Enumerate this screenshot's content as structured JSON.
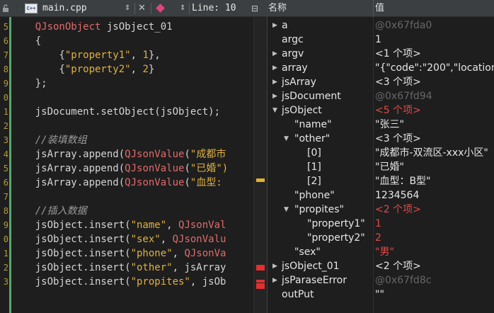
{
  "editor": {
    "file_name": "main.cpp",
    "file_dropdown_glyph": "⇕",
    "close_glyph": "✕",
    "symbol_dropdown_glyph": "⇕",
    "cursor_position": "Line: 10",
    "split_glyph": "⊟",
    "file_type_label": "C++",
    "line_numbers": [
      "5",
      "6",
      "7",
      "8",
      "9",
      "0",
      "1",
      "2",
      "3",
      "4",
      "5",
      "6",
      "7",
      "8",
      "9",
      "0",
      "1",
      "2",
      "3"
    ],
    "lines": [
      [
        {
          "t": "typ",
          "v": "    QJsonObject"
        },
        {
          "t": "pun",
          "v": " jsObject_01"
        }
      ],
      [
        {
          "t": "pun",
          "v": "    {"
        }
      ],
      [
        {
          "t": "pun",
          "v": "        {"
        },
        {
          "t": "str",
          "v": "\"property1\""
        },
        {
          "t": "pun",
          "v": ", "
        },
        {
          "t": "num",
          "v": "1"
        },
        {
          "t": "pun",
          "v": "},"
        }
      ],
      [
        {
          "t": "pun",
          "v": "        {"
        },
        {
          "t": "str",
          "v": "\"property2\""
        },
        {
          "t": "pun",
          "v": ", "
        },
        {
          "t": "num",
          "v": "2"
        },
        {
          "t": "pun",
          "v": "}"
        }
      ],
      [
        {
          "t": "pun",
          "v": "    };"
        }
      ],
      [
        {
          "t": "pun",
          "v": ""
        }
      ],
      [
        {
          "t": "fn",
          "v": "    jsDocument.setObject(jsObject);"
        }
      ],
      [
        {
          "t": "pun",
          "v": ""
        }
      ],
      [
        {
          "t": "cmt",
          "v": "    //装填数组"
        }
      ],
      [
        {
          "t": "fn",
          "v": "    jsArray.append("
        },
        {
          "t": "typ",
          "v": "QJsonValue"
        },
        {
          "t": "pun",
          "v": "("
        },
        {
          "t": "str",
          "v": "\"成都市"
        }
      ],
      [
        {
          "t": "fn",
          "v": "    jsArray.append("
        },
        {
          "t": "typ",
          "v": "QJsonValue"
        },
        {
          "t": "pun",
          "v": "("
        },
        {
          "t": "str",
          "v": "\"已婚\")"
        }
      ],
      [
        {
          "t": "fn",
          "v": "    jsArray.append("
        },
        {
          "t": "typ",
          "v": "QJsonValue"
        },
        {
          "t": "pun",
          "v": "("
        },
        {
          "t": "str",
          "v": "\"血型:"
        }
      ],
      [
        {
          "t": "pun",
          "v": ""
        }
      ],
      [
        {
          "t": "cmt",
          "v": "    //插入数据"
        }
      ],
      [
        {
          "t": "fn",
          "v": "    jsObject.insert("
        },
        {
          "t": "str",
          "v": "\"name\""
        },
        {
          "t": "pun",
          "v": ", "
        },
        {
          "t": "typ",
          "v": "QJsonVal"
        }
      ],
      [
        {
          "t": "fn",
          "v": "    jsObject.insert("
        },
        {
          "t": "str",
          "v": "\"sex\""
        },
        {
          "t": "pun",
          "v": ", "
        },
        {
          "t": "typ",
          "v": "QJsonValu"
        }
      ],
      [
        {
          "t": "fn",
          "v": "    jsObject.insert("
        },
        {
          "t": "str",
          "v": "\"phone\""
        },
        {
          "t": "pun",
          "v": ", "
        },
        {
          "t": "typ",
          "v": "QJsonVa"
        }
      ],
      [
        {
          "t": "fn",
          "v": "    jsObject.insert("
        },
        {
          "t": "str",
          "v": "\"other\""
        },
        {
          "t": "pun",
          "v": ", jsArray"
        }
      ],
      [
        {
          "t": "fn",
          "v": "    jsObject.insert("
        },
        {
          "t": "str",
          "v": "\"propites\""
        },
        {
          "t": "pun",
          "v": ", jsOb"
        }
      ]
    ]
  },
  "locals": {
    "header_name": "名称",
    "header_value": "值",
    "rows": [
      {
        "depth": 0,
        "arrow": "▶",
        "name": "a",
        "value": "@0x67fda0",
        "style": "addr"
      },
      {
        "depth": 0,
        "arrow": "",
        "name": "argc",
        "value": "1",
        "style": ""
      },
      {
        "depth": 0,
        "arrow": "▶",
        "name": "argv",
        "value": "<1 个项>",
        "style": ""
      },
      {
        "depth": 0,
        "arrow": "▶",
        "name": "array",
        "value": "\"{\"code\":\"200\",\"location",
        "style": ""
      },
      {
        "depth": 0,
        "arrow": "▶",
        "name": "jsArray",
        "value": "<3 个项>",
        "style": ""
      },
      {
        "depth": 0,
        "arrow": "▶",
        "name": "jsDocument",
        "value": "@0x67fd94",
        "style": "addr"
      },
      {
        "depth": 0,
        "arrow": "▼",
        "name": "jsObject",
        "value": "<5 个项>",
        "style": "changed"
      },
      {
        "depth": 1,
        "arrow": "",
        "name": "\"name\"",
        "value": "\"张三\"",
        "style": ""
      },
      {
        "depth": 1,
        "arrow": "▼",
        "name": "\"other\"",
        "value": "<3 个项>",
        "style": ""
      },
      {
        "depth": 2,
        "arrow": "",
        "name": "[0]",
        "value": "\"成都市-双流区-xxx小区\"",
        "style": ""
      },
      {
        "depth": 2,
        "arrow": "",
        "name": "[1]",
        "value": "\"已婚\"",
        "style": ""
      },
      {
        "depth": 2,
        "arrow": "",
        "name": "[2]",
        "value": "\"血型：B型\"",
        "style": ""
      },
      {
        "depth": 1,
        "arrow": "",
        "name": "\"phone\"",
        "value": "1234564",
        "style": ""
      },
      {
        "depth": 1,
        "arrow": "▼",
        "name": "\"propites\"",
        "value": "<2 个项>",
        "style": "changed"
      },
      {
        "depth": 2,
        "arrow": "",
        "name": "\"property1\"",
        "value": "1",
        "style": "changed"
      },
      {
        "depth": 2,
        "arrow": "",
        "name": "\"property2\"",
        "value": "2",
        "style": "changed"
      },
      {
        "depth": 1,
        "arrow": "",
        "name": "\"sex\"",
        "value": "\"男\"",
        "style": "changed"
      },
      {
        "depth": 0,
        "arrow": "▶",
        "name": "jsObject_01",
        "value": "<2 个项>",
        "style": ""
      },
      {
        "depth": 0,
        "arrow": "▶",
        "name": "jsParaseError",
        "value": "@0x67fd8c",
        "style": "addr"
      },
      {
        "depth": 0,
        "arrow": "",
        "name": "outPut",
        "value": "\"\"",
        "style": ""
      }
    ]
  },
  "colors": {
    "string": "#e0b040",
    "type": "#e06a6a",
    "changed_value": "#e04a4a",
    "address_value": "#666666",
    "gutter_change": "#59a869"
  },
  "icons": {
    "lock": "lock-icon",
    "file": "cpp-file-icon",
    "bookmark": "bookmark-icon",
    "split": "split-icon"
  }
}
